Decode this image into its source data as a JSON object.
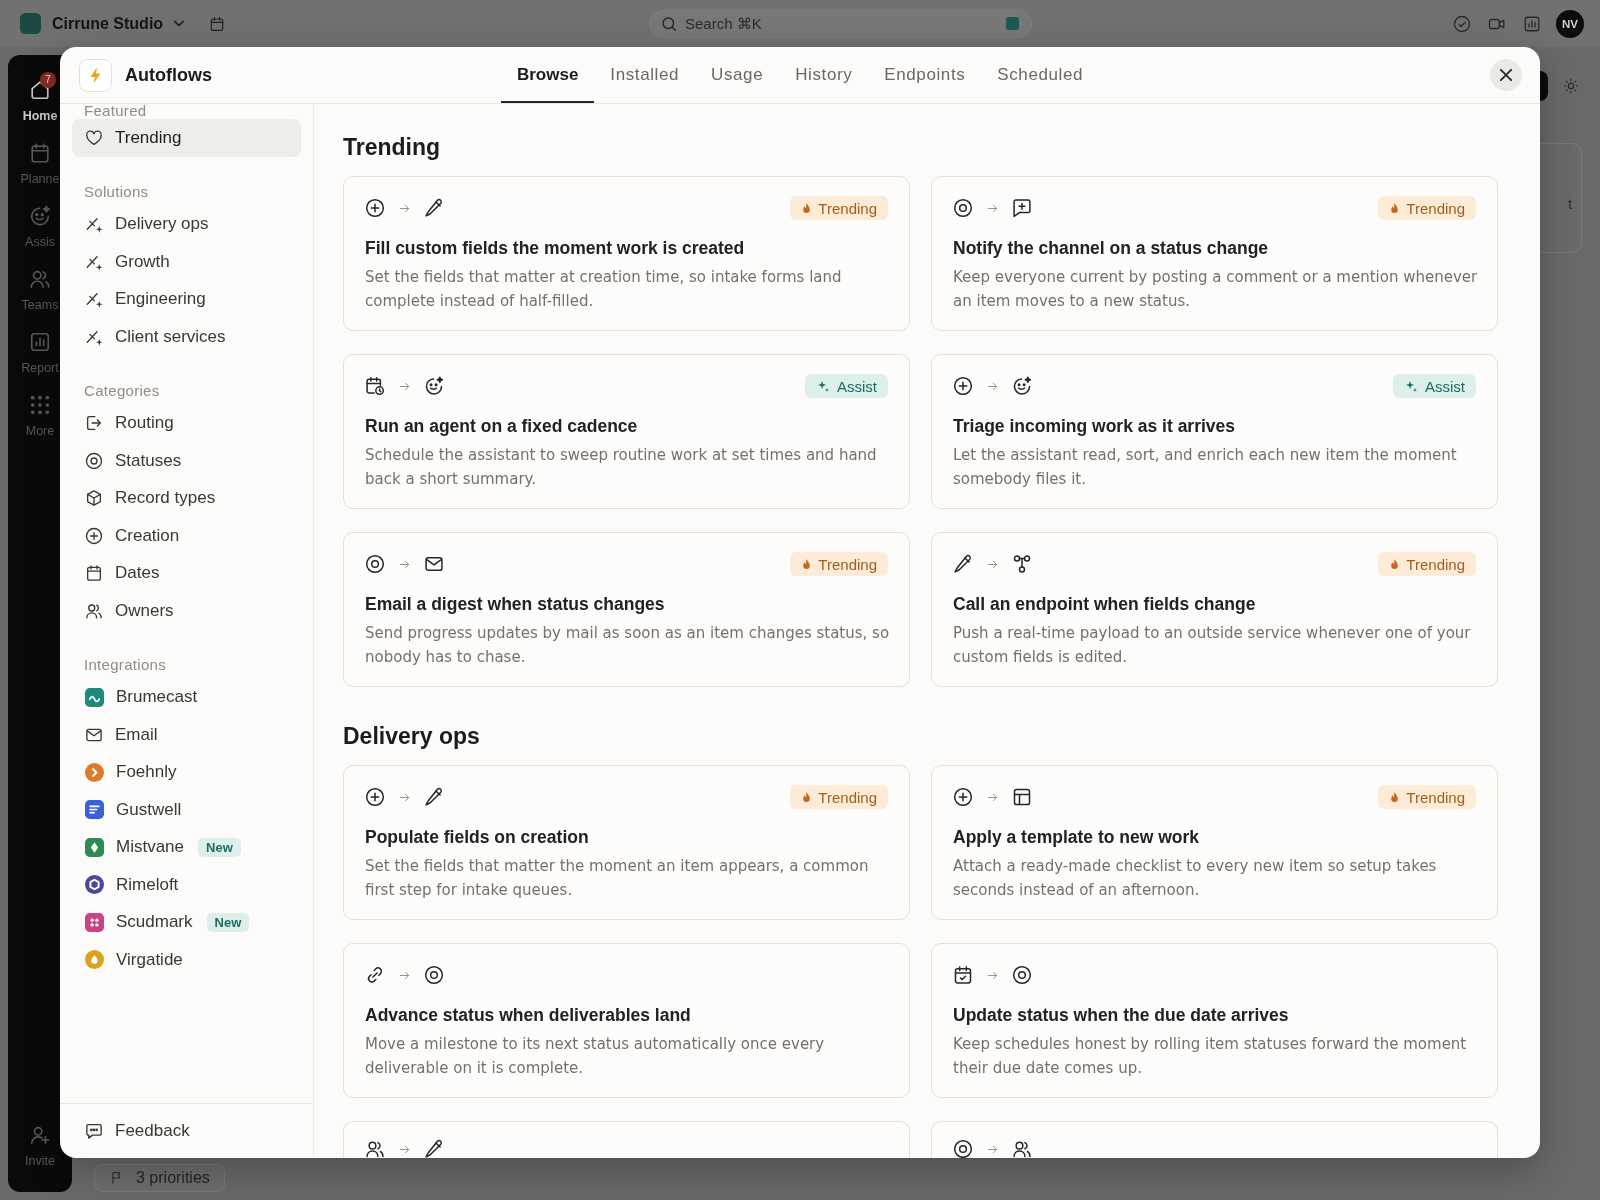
{
  "app": {
    "workspace": "Cirrune Studio",
    "search": {
      "placeholder": "Search ⌘K"
    },
    "avatar": "NV",
    "nav": [
      {
        "label": "Home",
        "selected": true,
        "badge": "7"
      },
      {
        "label": "Planne",
        "selected": false
      },
      {
        "label": "Assis",
        "selected": false
      },
      {
        "label": "Teams",
        "selected": false
      },
      {
        "label": "Report",
        "selected": false
      },
      {
        "label": "More",
        "selected": false
      }
    ],
    "invite": "Invite",
    "priorities": "3 priorities",
    "background_card": {
      "text": "t"
    }
  },
  "modal": {
    "title": "Autoflows",
    "tabs": [
      {
        "label": "Browse",
        "selected": true
      },
      {
        "label": "Installed",
        "selected": false
      },
      {
        "label": "Usage",
        "selected": false
      },
      {
        "label": "History",
        "selected": false
      },
      {
        "label": "Endpoints",
        "selected": false
      },
      {
        "label": "Scheduled",
        "selected": false
      }
    ],
    "sidebar": {
      "groups": [
        {
          "heading": "Featured",
          "items": [
            {
              "label": "Trending",
              "selected": true
            }
          ]
        },
        {
          "heading": "Solutions",
          "items": [
            {
              "label": "Delivery ops",
              "selected": false
            },
            {
              "label": "Growth",
              "selected": false
            },
            {
              "label": "Engineering",
              "selected": false
            },
            {
              "label": "Client services",
              "selected": false
            }
          ]
        },
        {
          "heading": "Categories",
          "items": [
            {
              "label": "Routing",
              "selected": false
            },
            {
              "label": "Statuses",
              "selected": false
            },
            {
              "label": "Record types",
              "selected": false
            },
            {
              "label": "Creation",
              "selected": false
            },
            {
              "label": "Dates",
              "selected": false
            },
            {
              "label": "Owners",
              "selected": false
            }
          ]
        },
        {
          "heading": "Integrations",
          "items": [
            {
              "label": "Brumecast",
              "selected": false,
              "color": "#1f8a7c"
            },
            {
              "label": "Email",
              "selected": false
            },
            {
              "label": "Foehnly",
              "selected": false,
              "color": "#e07a2b"
            },
            {
              "label": "Gustwell",
              "selected": false,
              "color": "#3a62d6"
            },
            {
              "label": "Mistvane",
              "selected": false,
              "color": "#2f8a58",
              "badge": "New"
            },
            {
              "label": "Rimeloft",
              "selected": false,
              "color": "#4b46a6"
            },
            {
              "label": "Scudmark",
              "selected": false,
              "color": "#c94482",
              "badge": "New"
            },
            {
              "label": "Virgatide",
              "selected": false,
              "color": "#d9a21f"
            }
          ]
        }
      ],
      "footer": {
        "label": "Feedback"
      }
    },
    "sections": [
      {
        "heading": "Trending",
        "cards": [
          {
            "kind": "full",
            "title": "Fill custom fields the moment work is created",
            "description": "Set the fields that matter at creation time, so intake forms land complete instead of half-filled.",
            "badge": {
              "kind": "trending",
              "label": "Trending"
            }
          },
          {
            "kind": "full",
            "title": "Notify the channel on a status change",
            "description": "Keep everyone current by posting a comment or a mention whenever an item moves to a new status.",
            "badge": {
              "kind": "trending",
              "label": "Trending"
            }
          },
          {
            "kind": "full",
            "title": "Run an agent on a fixed cadence",
            "description": "Schedule the assistant to sweep routine work at set times and hand back a short summary.",
            "badge": {
              "kind": "assist",
              "label": "Assist"
            }
          },
          {
            "kind": "full",
            "title": "Triage incoming work as it arrives",
            "description": "Let the assistant read, sort, and enrich each new item the moment somebody files it.",
            "badge": {
              "kind": "assist",
              "label": "Assist"
            }
          },
          {
            "kind": "full",
            "title": "Email a digest when status changes",
            "description": "Send progress updates by mail as soon as an item changes status, so nobody has to chase.",
            "badge": {
              "kind": "trending",
              "label": "Trending"
            }
          },
          {
            "kind": "full",
            "title": "Call an endpoint when fields change",
            "description": "Push a real-time payload to an outside service whenever one of your custom fields is edited.",
            "badge": {
              "kind": "trending",
              "label": "Trending"
            }
          }
        ]
      },
      {
        "heading": "Delivery ops",
        "cards": [
          {
            "kind": "full",
            "title": "Populate fields on creation",
            "description": "Set the fields that matter the moment an item appears, a common first step for intake queues.",
            "badge": {
              "kind": "trending",
              "label": "Trending"
            }
          },
          {
            "kind": "full",
            "title": "Apply a template to new work",
            "description": "Attach a ready-made checklist to every new item so setup takes seconds instead of an afternoon.",
            "badge": {
              "kind": "trending",
              "label": "Trending"
            }
          },
          {
            "kind": "full",
            "title": "Advance status when deliverables land",
            "description": "Move a milestone to its next status automatically once every deliverable on it is complete."
          },
          {
            "kind": "full",
            "title": "Update status when the due date arrives",
            "description": "Keep schedules honest by rolling item statuses forward the moment their due date comes up."
          },
          {
            "kind": "clipped"
          },
          {
            "kind": "clipped"
          }
        ]
      }
    ]
  }
}
